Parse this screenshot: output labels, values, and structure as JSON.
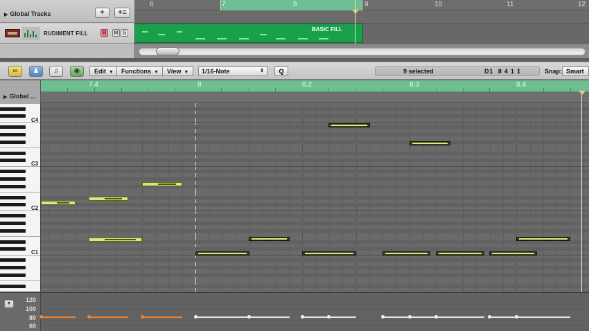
{
  "arrange": {
    "global_tracks_label": "Global Tracks",
    "add_track_label": "+",
    "add_folder_label": "+",
    "track": {
      "name": "RUDIMENT FILL",
      "rec_label": "R",
      "mute_label": "M",
      "solo_label": "S"
    },
    "region_name": "BASIC FILL",
    "bar_numbers": [
      "6",
      "7",
      "8",
      "9",
      "10",
      "11",
      "12"
    ]
  },
  "toolbar": {
    "edit_label": "Edit",
    "functions_label": "Functions",
    "view_label": "View",
    "quantize_value": "1/16-Note",
    "q_label": "Q",
    "selection_info": "9 selected",
    "position_note": "D1",
    "position_value": "8 4 1 1",
    "snap_label": "Snap:",
    "snap_value": "Smart"
  },
  "piano_roll": {
    "global_label": "Global ...",
    "ruler_labels": [
      "7.4",
      "8",
      "8.2",
      "8.3",
      "8.4"
    ],
    "octave_labels": [
      "C4",
      "C3",
      "C2",
      "C1"
    ],
    "velocity_labels": [
      "120",
      "100",
      "80",
      "60"
    ]
  },
  "colors": {
    "region": "#18a04a",
    "cycle": "#6dbf92",
    "note_selected": "#d6e78a",
    "velocity_selected": "#e8872f"
  }
}
